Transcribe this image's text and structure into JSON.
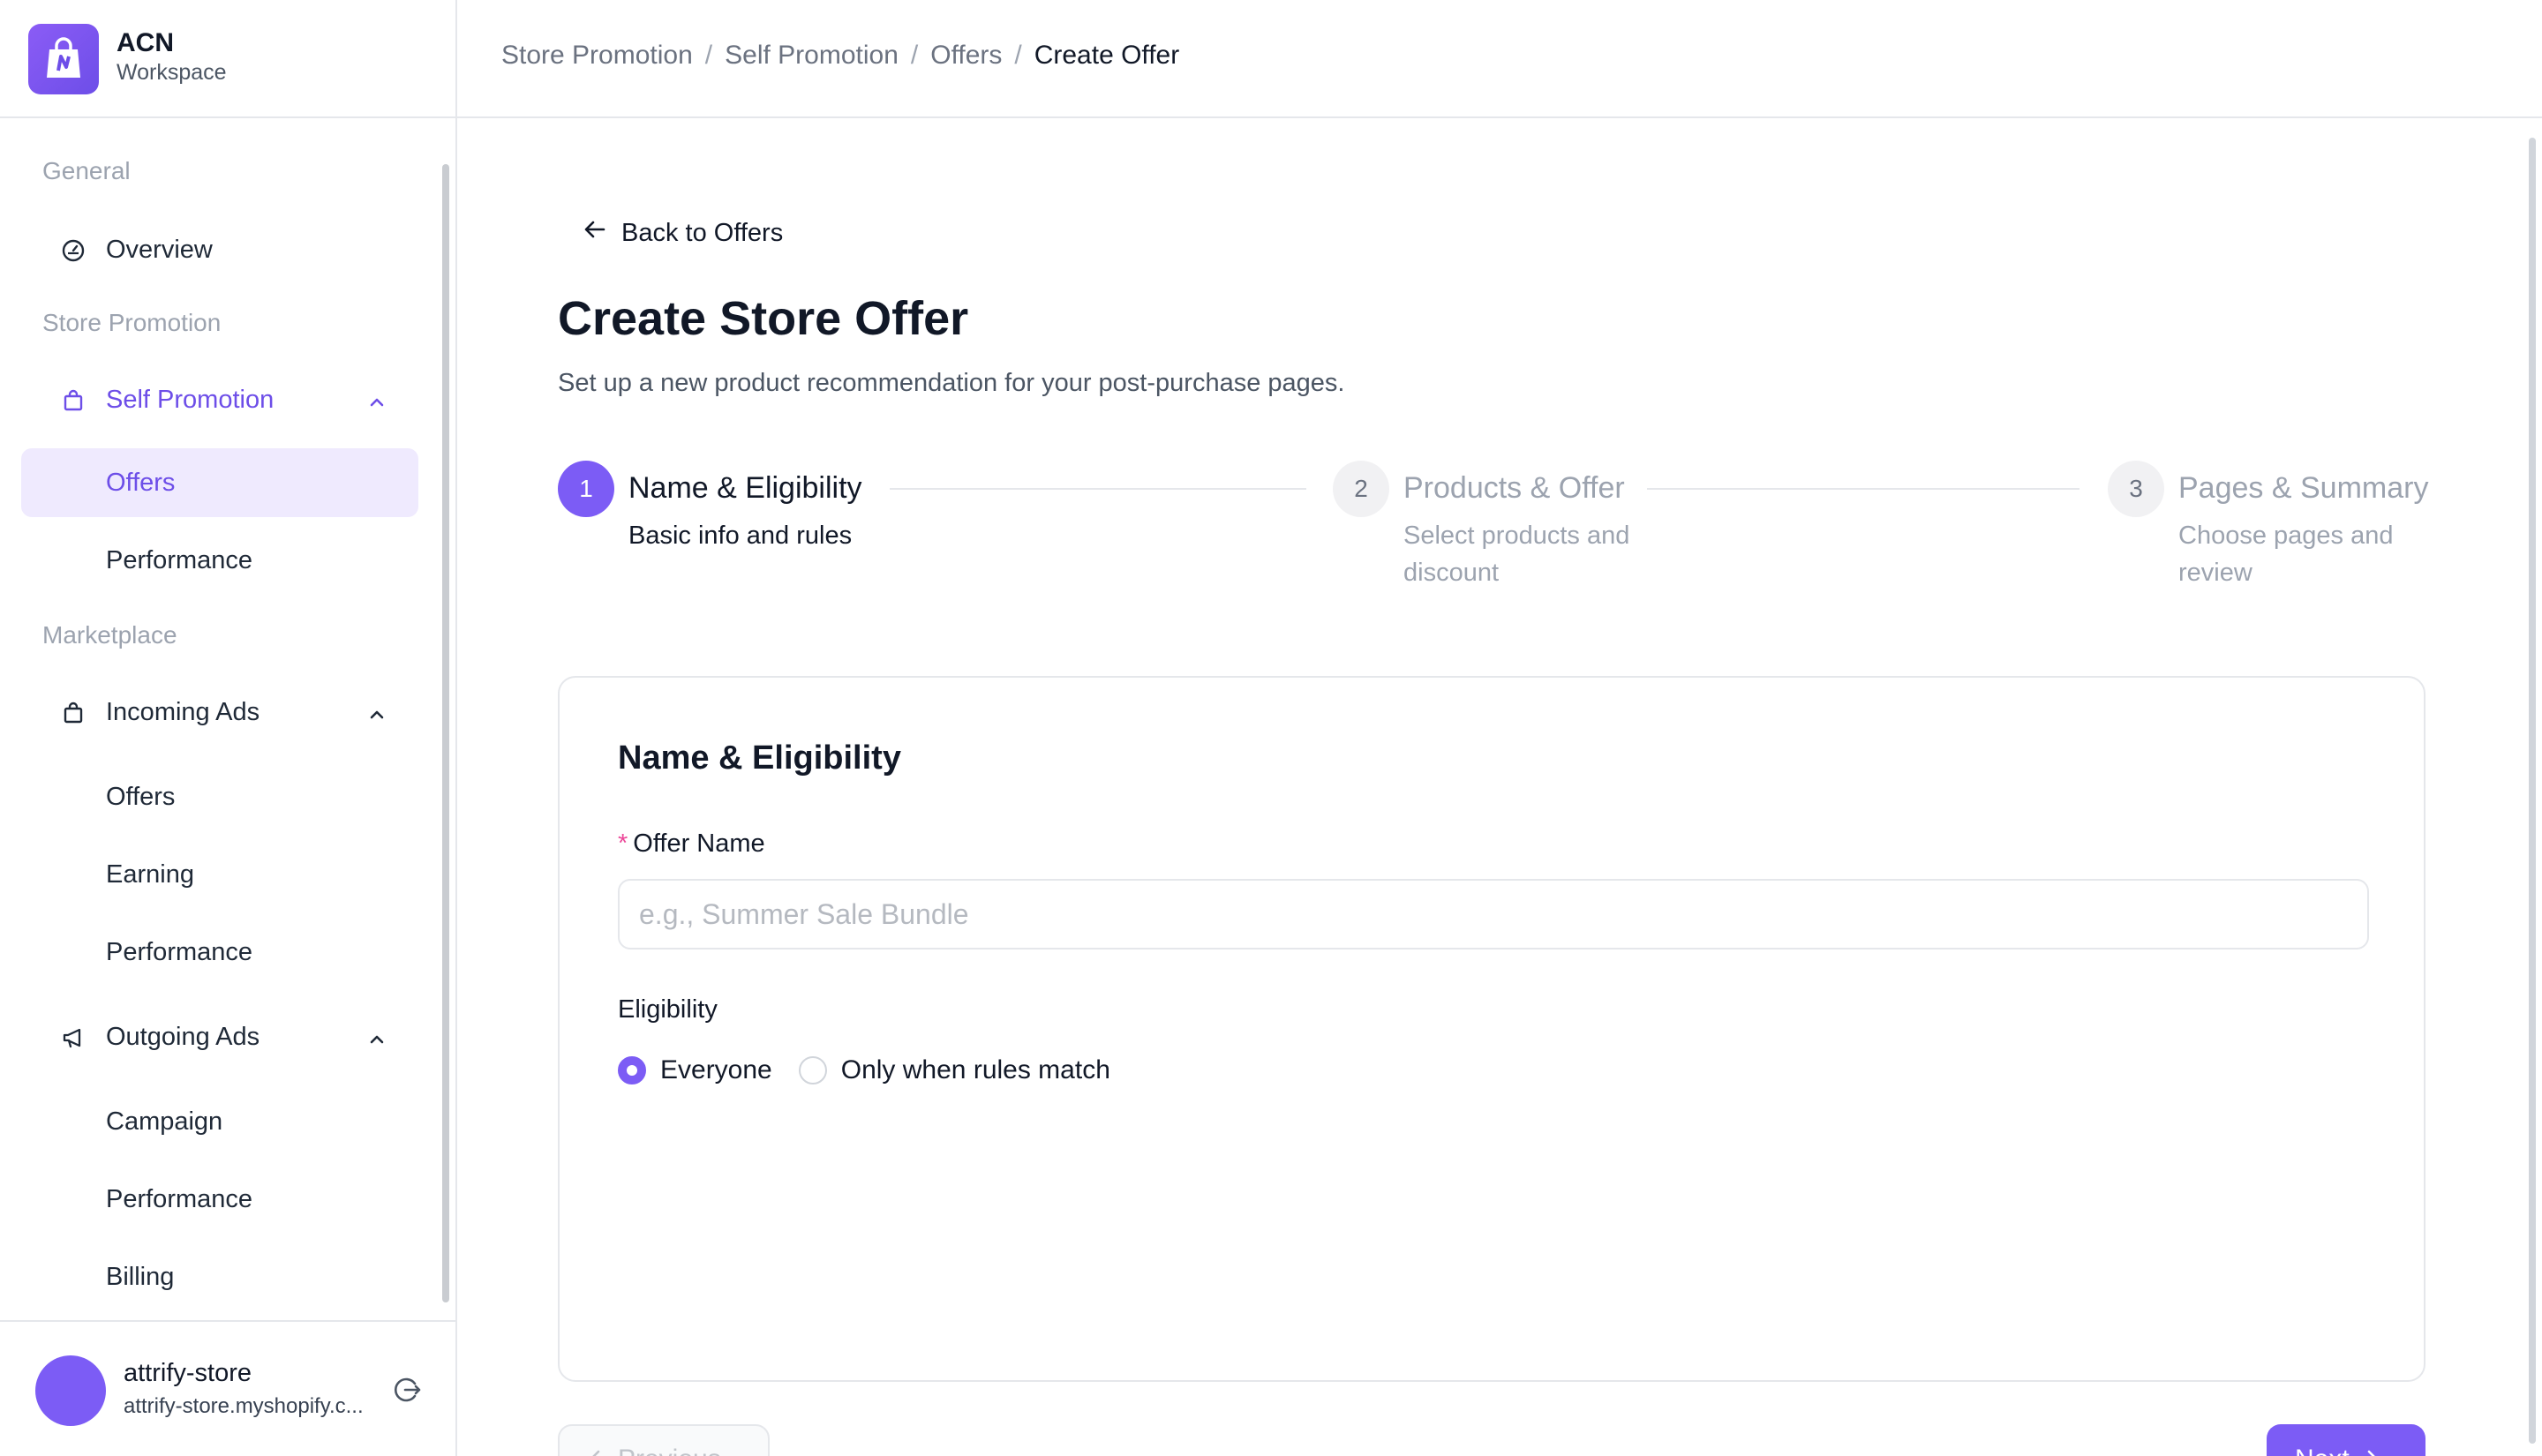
{
  "brand": {
    "name": "ACN",
    "subtitle": "Workspace"
  },
  "breadcrumb": {
    "items": [
      "Store Promotion",
      "Self Promotion",
      "Offers"
    ],
    "current": "Create Offer"
  },
  "sidebar": {
    "sections": [
      {
        "label": "General"
      },
      {
        "label": "Store Promotion"
      },
      {
        "label": "Marketplace"
      }
    ],
    "overview": "Overview",
    "self_promotion": {
      "label": "Self Promotion",
      "children": [
        "Offers",
        "Performance"
      ]
    },
    "incoming_ads": {
      "label": "Incoming Ads",
      "children": [
        "Offers",
        "Earning",
        "Performance"
      ]
    },
    "outgoing_ads": {
      "label": "Outgoing Ads",
      "children": [
        "Campaign",
        "Performance",
        "Billing"
      ]
    }
  },
  "user": {
    "name": "attrify-store",
    "domain": "attrify-store.myshopify.c..."
  },
  "page": {
    "back_label": "Back to Offers",
    "title": "Create Store Offer",
    "subtitle": "Set up a new product recommendation for your post-purchase pages."
  },
  "steps": [
    {
      "number": "1",
      "title": "Name & Eligibility",
      "desc": "Basic info and rules",
      "active": true
    },
    {
      "number": "2",
      "title": "Products & Offer",
      "desc": "Select products and discount",
      "active": false
    },
    {
      "number": "3",
      "title": "Pages & Summary",
      "desc": "Choose pages and review",
      "active": false
    }
  ],
  "form": {
    "card_title": "Name & Eligibility",
    "offer_name_label": "Offer Name",
    "offer_name_placeholder": "e.g., Summer Sale Bundle",
    "offer_name_value": "",
    "eligibility_label": "Eligibility",
    "eligibility_options": [
      "Everyone",
      "Only when rules match"
    ],
    "eligibility_selected": "Everyone"
  },
  "footer": {
    "prev_label": "Previous",
    "next_label": "Next"
  },
  "colors": {
    "accent": "#7c5cf5",
    "accent_bg": "#efeafe",
    "border": "#e5e7eb"
  }
}
